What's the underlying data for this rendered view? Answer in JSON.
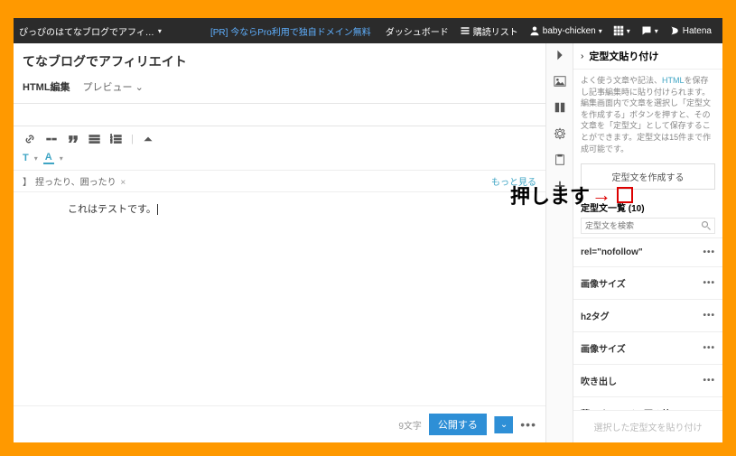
{
  "topbar": {
    "title": "ぴっぴのはてなブログでアフィ…",
    "pr_text": "[PR] 今ならPro利用で独自ドメイン無料",
    "nav_dashboard": "ダッシュボード",
    "nav_readlist": "購読リスト",
    "username": "baby-chicken",
    "brand": "Hatena"
  },
  "editor": {
    "page_title": "てなブログでアフィリエイト",
    "tab_html": "HTML編集",
    "tab_preview": "プレビュー",
    "row2_t": "T",
    "row2_a": "A",
    "category_tag": "捏ったり、囲ったり",
    "more_link": "もっと見る",
    "body_text": "これはテストです。",
    "char_count": "9文字",
    "publish_label": "公開する"
  },
  "sidepanel": {
    "title": "定型文貼り付け",
    "desc_1": "よく使う文章や記法、",
    "desc_hl": "HTML",
    "desc_2": "を保存し記事編集時に貼り付けられます。編集画面内で文章を選択し「定型文を作成する」ボタンを押すと、その文章を「定型文」として保存することができます。定型文は15件まで作成可能です。",
    "create_btn": "定型文を作成する",
    "list_heading": "定型文一覧 (10)",
    "search_placeholder": "定型文を検索",
    "items": [
      {
        "label": "rel=\"nofollow\""
      },
      {
        "label": "画像サイズ"
      },
      {
        "label": "h2タグ"
      },
      {
        "label": "画像サイズ"
      },
      {
        "label": "吹き出し"
      },
      {
        "label": "薄いオレンジの囲み枠"
      }
    ],
    "footer": "選択した定型文を貼り付け"
  },
  "annotation": {
    "text": "押します",
    "arrow": "→"
  }
}
